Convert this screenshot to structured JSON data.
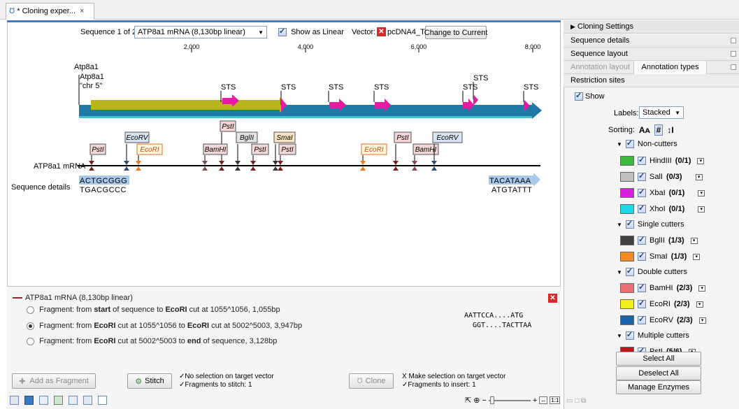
{
  "tab": {
    "title": "* Cloning exper...",
    "close": "×"
  },
  "seqbar": {
    "sequence_label": "Sequence 1 of 2:",
    "sequence_value": "ATP8a1 mRNA (8,130bp linear)",
    "show_linear": "Show as Linear",
    "vector_label": "Vector:",
    "vector_value": "pcDNA4_TO",
    "change_button": "Change to Current"
  },
  "ruler": [
    "2,000",
    "4,000",
    "6,000",
    "8,000"
  ],
  "annotations": {
    "atp_top": "Atp8a1",
    "atp_mid": "Atp8a1",
    "chr": "\"chr 5\"",
    "sts": [
      "STS",
      "STS",
      "STS",
      "STS",
      "STS",
      "STS",
      "STS"
    ]
  },
  "enzyme_labels": [
    "PstI",
    "EcoRV",
    "EcoRI",
    "PstI",
    "BamHI",
    "BglII",
    "PstI",
    "SmaI",
    "PstI",
    "EcoRI",
    "PstI",
    "BamHI",
    "EcoRV"
  ],
  "track": {
    "name": "ATP8a1 mRNA",
    "details_label": "Sequence details",
    "seq_start_top": "ACTGCGGG",
    "seq_start_bottom": "TGACGCCC",
    "seq_end_top": "TACATAAA",
    "seq_end_bottom": "ATGTATTT"
  },
  "fragments": {
    "header": "ATP8a1 mRNA (8,130bp linear)",
    "items": [
      {
        "pre": "Fragment: from ",
        "b1": "start",
        "mid": " of sequence to ",
        "b2": "EcoRI",
        "post": " cut at 1055^1056, 1,055bp",
        "selected": false
      },
      {
        "pre": "Fragment: from ",
        "b1": "EcoRI",
        "mid": " cut at 1055^1056 to ",
        "b2": "EcoRI",
        "post": " cut at 5002^5003, 3,947bp",
        "selected": true
      },
      {
        "pre": "Fragment: from ",
        "b1": "EcoRI",
        "mid": " cut at 5002^5003 to ",
        "b2": "end",
        "post": " of sequence, 3,128bp",
        "selected": false
      }
    ],
    "overhang_top": "AATTCCA....ATG",
    "overhang_bottom": "GGT....TACTTAA"
  },
  "actions": {
    "add_fragment": "Add as Fragment",
    "stitch": "Stitch",
    "stitch_info_1": "✓No selection on target vector",
    "stitch_info_2": "✓Fragments to stitch: 1",
    "clone": "Clone",
    "clone_info_1": "X Make selection on target vector",
    "clone_info_2": "✓Fragments to insert: 1"
  },
  "right": {
    "title": "Cloning Settings",
    "sections": [
      "Sequence details",
      "Sequence layout"
    ],
    "tab_inactive": "Annotation layout",
    "tab_active": "Annotation types",
    "restriction": "Restriction sites",
    "show": "Show",
    "labels_label": "Labels:",
    "labels_value": "Stacked",
    "sorting_label": "Sorting:",
    "groups": [
      {
        "name": "Non-cutters",
        "enzymes": [
          {
            "name": "HindIII",
            "count": "(0/1)",
            "color": "#3cb83c"
          },
          {
            "name": "SalI",
            "count": "(0/3)",
            "color": "#bfbfbf"
          },
          {
            "name": "XbaI",
            "count": "(0/1)",
            "color": "#d91ee0"
          },
          {
            "name": "XhoI",
            "count": "(0/1)",
            "color": "#1ed6e8"
          }
        ]
      },
      {
        "name": "Single cutters",
        "enzymes": [
          {
            "name": "BglII",
            "count": "(1/3)",
            "color": "#404040"
          },
          {
            "name": "SmaI",
            "count": "(1/3)",
            "color": "#f08a24"
          }
        ]
      },
      {
        "name": "Double cutters",
        "enzymes": [
          {
            "name": "BamHI",
            "count": "(2/3)",
            "color": "#e87070"
          },
          {
            "name": "EcoRI",
            "count": "(2/3)",
            "color": "#f2ee1a"
          },
          {
            "name": "EcoRV",
            "count": "(2/3)",
            "color": "#1a62aa"
          }
        ]
      },
      {
        "name": "Multiple cutters",
        "enzymes": [
          {
            "name": "PstI",
            "count": "(5/6)",
            "color": "#b81818"
          }
        ]
      }
    ],
    "select_all": "Select All",
    "deselect_all": "Deselect All",
    "manage": "Manage Enzymes"
  }
}
